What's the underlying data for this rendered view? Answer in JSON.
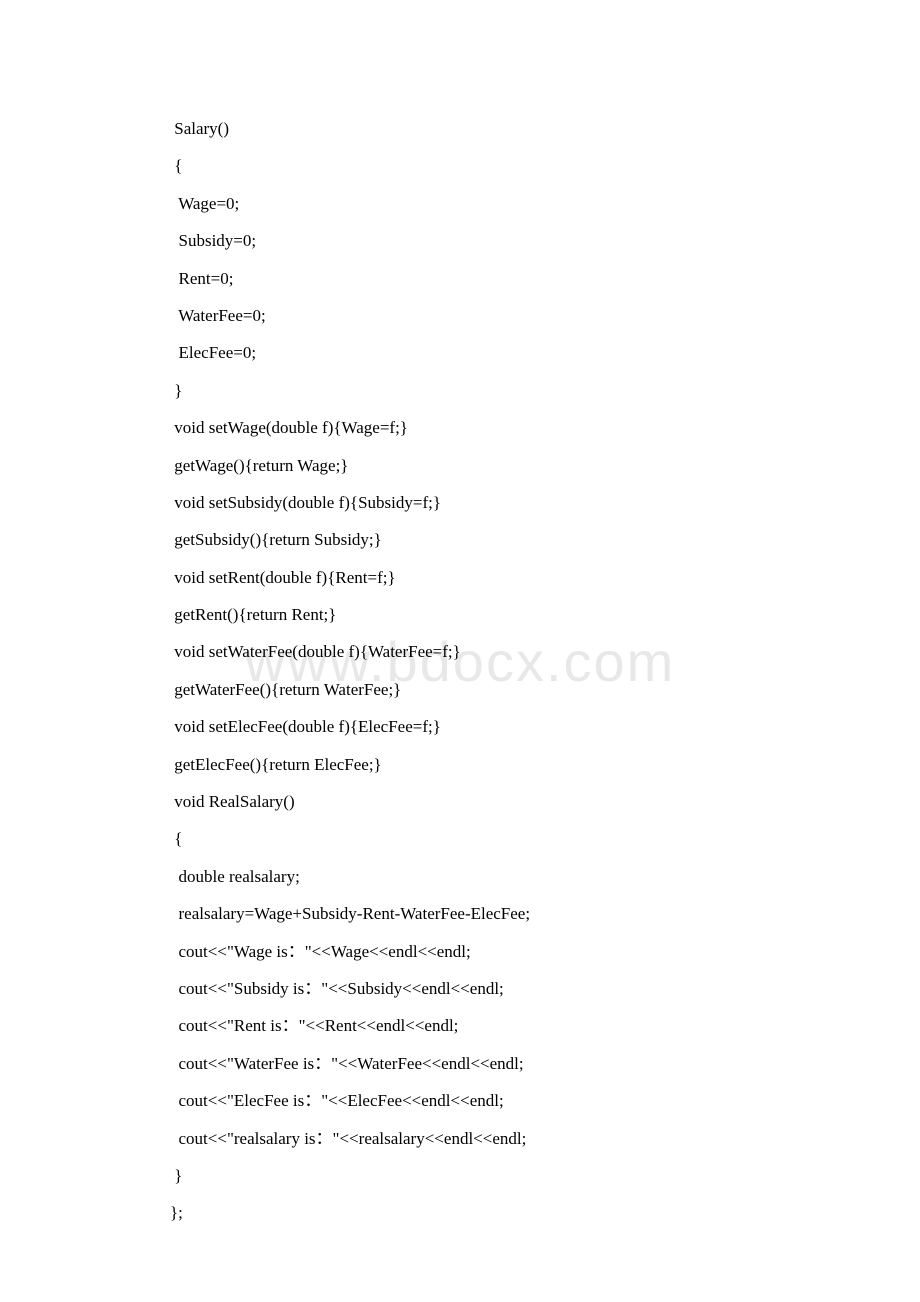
{
  "watermark": "www.bdocx.com",
  "code": {
    "lines": [
      " Salary()",
      " {",
      "  Wage=0;",
      "  Subsidy=0;",
      "  Rent=0;",
      "  WaterFee=0;",
      "  ElecFee=0;",
      " }",
      " void setWage(double f){Wage=f;}",
      " getWage(){return Wage;}",
      " void setSubsidy(double f){Subsidy=f;}",
      " getSubsidy(){return Subsidy;}",
      " void setRent(double f){Rent=f;}",
      " getRent(){return Rent;}",
      " void setWaterFee(double f){WaterFee=f;}",
      " getWaterFee(){return WaterFee;}",
      " void setElecFee(double f){ElecFee=f;}",
      " getElecFee(){return ElecFee;}",
      " void RealSalary()",
      " {",
      "  double realsalary;",
      "  realsalary=Wage+Subsidy-Rent-WaterFee-ElecFee;",
      "  cout<<\"Wage is：\"<<Wage<<endl<<endl;",
      "  cout<<\"Subsidy is：\"<<Subsidy<<endl<<endl;",
      "  cout<<\"Rent is：\"<<Rent<<endl<<endl;",
      "  cout<<\"WaterFee is：\"<<WaterFee<<endl<<endl;",
      "  cout<<\"ElecFee is：\"<<ElecFee<<endl<<endl;",
      "  cout<<\"realsalary is：\"<<realsalary<<endl<<endl;",
      " }",
      "};"
    ]
  }
}
